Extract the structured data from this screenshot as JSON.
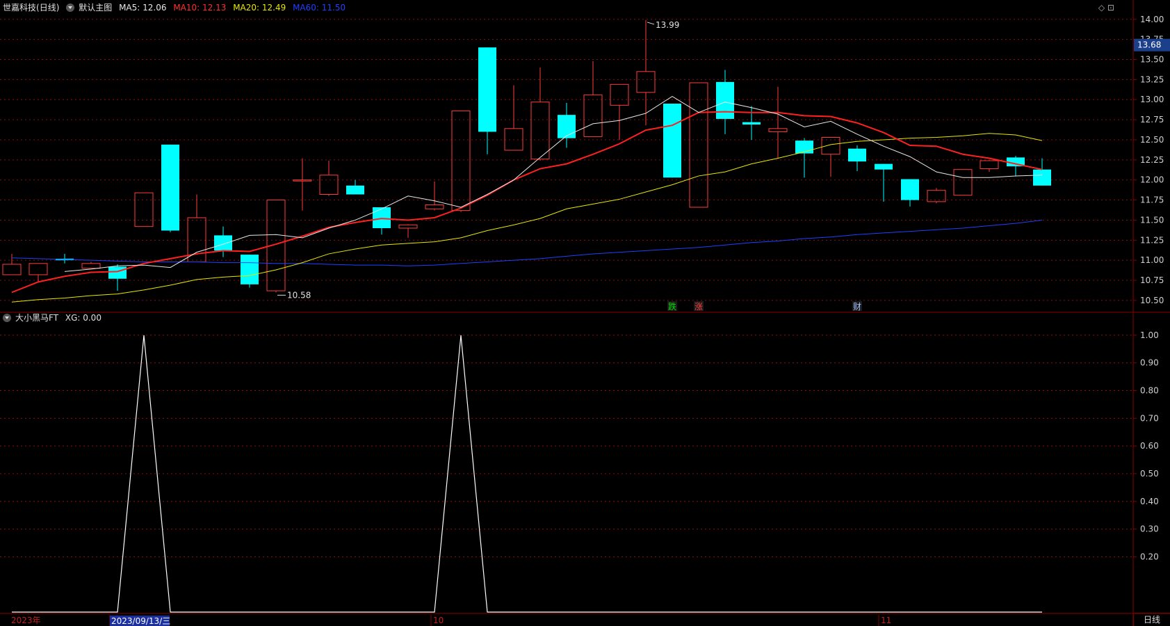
{
  "header": {
    "stock": "世嘉科技",
    "period": "(日线)",
    "main_name": "默认主图",
    "ma5_label": "MA5: 12.06",
    "ma10_label": "MA10: 12.13",
    "ma20_label": "MA20: 12.49",
    "ma60_label": "MA60: 11.50"
  },
  "sub_header": {
    "name": "大小黑马FT",
    "value_label": "XG: 0.00"
  },
  "price_axis": [
    "14.00",
    "13.75",
    "13.50",
    "13.25",
    "13.00",
    "12.75",
    "12.50",
    "12.25",
    "12.00",
    "11.75",
    "11.50",
    "11.25",
    "11.00",
    "10.75",
    "10.50"
  ],
  "current_price": "13.68",
  "high_marker": "13.99",
  "low_marker": "10.58",
  "sub_axis": [
    "1.00",
    "0.90",
    "0.80",
    "0.70",
    "0.60",
    "0.50",
    "0.40",
    "0.30",
    "0.20"
  ],
  "date_axis": {
    "year": "2023年",
    "cursor_date": "2023/09/13/三",
    "oct": "10",
    "nov": "11"
  },
  "event_marks": [
    {
      "text": "跌",
      "color": "#00e000",
      "candle": 25
    },
    {
      "text": "涨",
      "color": "#ff4040",
      "candle": 26
    },
    {
      "text": "财",
      "color": "#a0c0ff",
      "candle": 32
    }
  ],
  "period_button": "日线",
  "colors": {
    "up": "#ff3c3c",
    "down": "#00ffff",
    "ma5": "#e8e8e8",
    "ma10": "#ff2020",
    "ma20": "#e8e800",
    "ma60": "#2040ff",
    "grid": "#8a1010",
    "frame": "#8a0000"
  },
  "chart_data": {
    "type": "candlestick",
    "price_range": [
      10.43,
      14.05
    ],
    "candles": [
      {
        "o": 10.82,
        "c": 10.95,
        "h": 11.08,
        "l": 10.82
      },
      {
        "o": 10.82,
        "c": 10.96,
        "h": 10.96,
        "l": 10.74
      },
      {
        "o": 11.02,
        "c": 11.0,
        "h": 11.08,
        "l": 10.96
      },
      {
        "o": 10.9,
        "c": 10.96,
        "h": 10.98,
        "l": 10.9
      },
      {
        "o": 10.92,
        "c": 10.77,
        "h": 10.95,
        "l": 10.62
      },
      {
        "o": 11.42,
        "c": 11.84,
        "h": 11.84,
        "l": 11.42
      },
      {
        "o": 12.44,
        "c": 11.37,
        "h": 12.44,
        "l": 11.35
      },
      {
        "o": 10.98,
        "c": 11.53,
        "h": 11.82,
        "l": 10.98
      },
      {
        "o": 11.31,
        "c": 11.12,
        "h": 11.42,
        "l": 11.04
      },
      {
        "o": 11.07,
        "c": 10.7,
        "h": 11.07,
        "l": 10.66
      },
      {
        "o": 10.62,
        "c": 11.75,
        "h": 11.75,
        "l": 10.6
      },
      {
        "o": 12.0,
        "c": 12.0,
        "h": 12.27,
        "l": 11.62
      },
      {
        "o": 11.82,
        "c": 12.06,
        "h": 12.24,
        "l": 11.8
      },
      {
        "o": 11.93,
        "c": 11.82,
        "h": 12.0,
        "l": 11.82
      },
      {
        "o": 11.66,
        "c": 11.4,
        "h": 11.66,
        "l": 11.32
      },
      {
        "o": 11.4,
        "c": 11.44,
        "h": 11.45,
        "l": 11.28
      },
      {
        "o": 11.64,
        "c": 11.69,
        "h": 11.98,
        "l": 11.62
      },
      {
        "o": 11.62,
        "c": 12.86,
        "h": 12.86,
        "l": 11.6
      },
      {
        "o": 13.65,
        "c": 12.6,
        "h": 13.65,
        "l": 12.32
      },
      {
        "o": 12.37,
        "c": 12.64,
        "h": 13.18,
        "l": 12.37
      },
      {
        "o": 12.26,
        "c": 12.97,
        "h": 13.4,
        "l": 12.24
      },
      {
        "o": 12.81,
        "c": 12.52,
        "h": 12.96,
        "l": 12.4
      },
      {
        "o": 12.54,
        "c": 13.06,
        "h": 13.48,
        "l": 12.54
      },
      {
        "o": 12.93,
        "c": 13.19,
        "h": 13.19,
        "l": 12.5
      },
      {
        "o": 13.09,
        "c": 13.35,
        "h": 13.99,
        "l": 12.68
      },
      {
        "o": 12.95,
        "c": 12.03,
        "h": 12.95,
        "l": 12.03
      },
      {
        "o": 11.66,
        "c": 13.21,
        "h": 13.21,
        "l": 11.66
      },
      {
        "o": 13.22,
        "c": 12.76,
        "h": 13.37,
        "l": 12.57
      },
      {
        "o": 12.72,
        "c": 12.69,
        "h": 12.92,
        "l": 12.5
      },
      {
        "o": 12.6,
        "c": 12.64,
        "h": 13.16,
        "l": 12.27
      },
      {
        "o": 12.49,
        "c": 12.33,
        "h": 12.52,
        "l": 12.03
      },
      {
        "o": 12.32,
        "c": 12.53,
        "h": 12.53,
        "l": 12.04
      },
      {
        "o": 12.39,
        "c": 12.23,
        "h": 12.43,
        "l": 12.11
      },
      {
        "o": 12.2,
        "c": 12.13,
        "h": 12.2,
        "l": 11.73
      },
      {
        "o": 12.01,
        "c": 11.75,
        "h": 12.01,
        "l": 11.67
      },
      {
        "o": 11.73,
        "c": 11.87,
        "h": 11.9,
        "l": 11.71
      },
      {
        "o": 11.81,
        "c": 12.13,
        "h": 12.13,
        "l": 11.81
      },
      {
        "o": 12.14,
        "c": 12.24,
        "h": 12.24,
        "l": 12.1
      },
      {
        "o": 12.28,
        "c": 12.17,
        "h": 12.3,
        "l": 12.05
      },
      {
        "o": 12.13,
        "c": 11.93,
        "h": 12.27,
        "l": 11.93
      }
    ],
    "ma5": [
      10.86,
      10.89,
      10.93,
      10.94,
      10.91,
      11.1,
      11.2,
      11.31,
      11.32,
      11.28,
      11.4,
      11.5,
      11.64,
      11.8,
      11.74,
      11.66,
      11.82,
      12.0,
      12.28,
      12.55,
      12.7,
      12.74,
      12.83,
      13.04,
      12.84,
      12.97,
      12.9,
      12.82,
      12.66,
      12.73,
      12.57,
      12.42,
      12.29,
      12.1,
      12.03,
      12.03,
      12.05,
      12.06
    ],
    "ma10": [
      10.6,
      10.73,
      10.8,
      10.85,
      10.86,
      10.96,
      11.02,
      11.08,
      11.12,
      11.11,
      11.2,
      11.3,
      11.41,
      11.47,
      11.52,
      11.5,
      11.53,
      11.65,
      11.81,
      12.0,
      12.14,
      12.2,
      12.32,
      12.45,
      12.62,
      12.68,
      12.84,
      12.85,
      12.84,
      12.84,
      12.8,
      12.79,
      12.71,
      12.59,
      12.43,
      12.42,
      12.32,
      12.27,
      12.2,
      12.13
    ],
    "ma20": [
      10.48,
      10.51,
      10.53,
      10.56,
      10.58,
      10.63,
      10.69,
      10.76,
      10.79,
      10.81,
      10.88,
      10.97,
      11.08,
      11.14,
      11.19,
      11.21,
      11.23,
      11.28,
      11.37,
      11.44,
      11.52,
      11.64,
      11.7,
      11.76,
      11.85,
      11.94,
      12.05,
      12.1,
      12.2,
      12.27,
      12.35,
      12.44,
      12.48,
      12.5,
      12.52,
      12.53,
      12.55,
      12.58,
      12.56,
      12.49
    ],
    "ma60": [
      11.03,
      11.02,
      11.01,
      11.0,
      10.99,
      10.98,
      10.98,
      10.98,
      10.97,
      10.97,
      10.96,
      10.96,
      10.95,
      10.94,
      10.94,
      10.93,
      10.94,
      10.96,
      10.98,
      11.0,
      11.02,
      11.05,
      11.08,
      11.1,
      11.12,
      11.14,
      11.16,
      11.19,
      11.22,
      11.24,
      11.27,
      11.29,
      11.32,
      11.34,
      11.36,
      11.38,
      11.4,
      11.43,
      11.46,
      11.5
    ],
    "xg": [
      0,
      0,
      0,
      0,
      0,
      1,
      0,
      0,
      0,
      0,
      0,
      0,
      0,
      0,
      0,
      0,
      0,
      1,
      0,
      0,
      0,
      0,
      0,
      0,
      0,
      0,
      0,
      0,
      0,
      0,
      0,
      0,
      0,
      0,
      0,
      0,
      0,
      0,
      0,
      0
    ],
    "sub_range": [
      0.0,
      1.05
    ]
  }
}
